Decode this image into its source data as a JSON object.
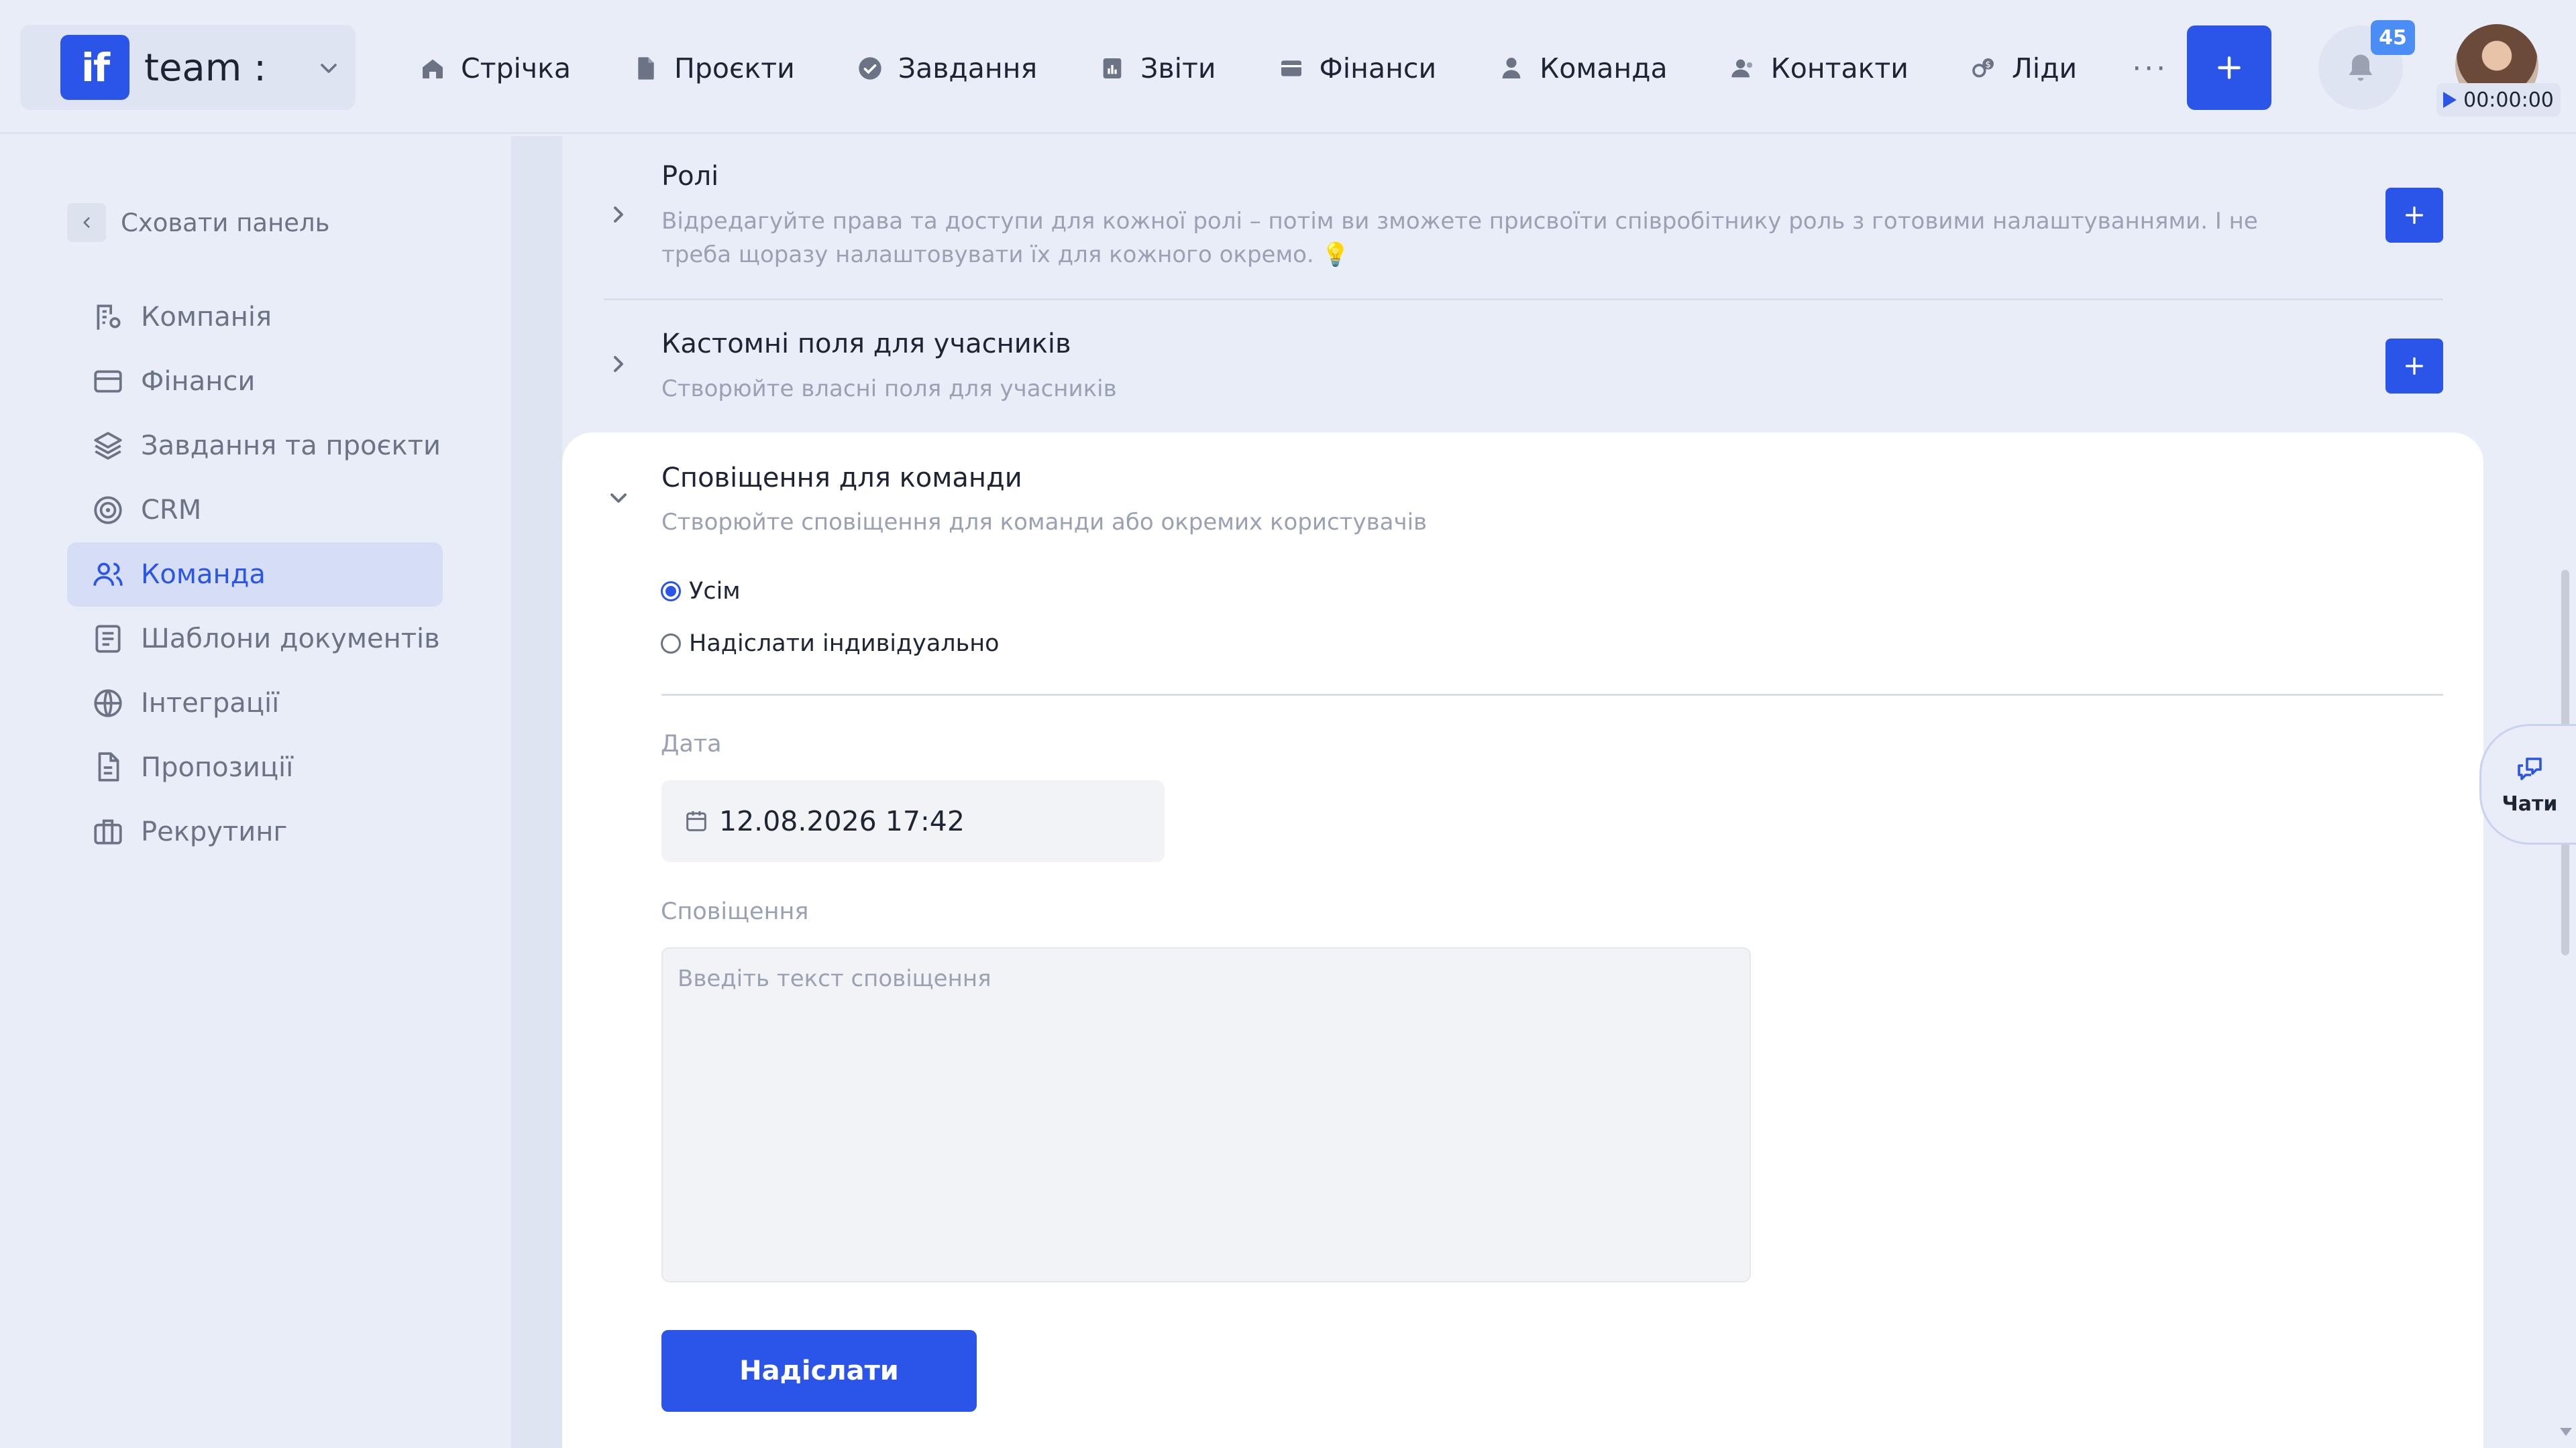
{
  "workspace": {
    "logo": "if",
    "name": "team :"
  },
  "nav": [
    {
      "label": "Стрічка",
      "icon": "home-icon"
    },
    {
      "label": "Проєкти",
      "icon": "document-icon"
    },
    {
      "label": "Завдання",
      "icon": "check-circle-icon"
    },
    {
      "label": "Звіти",
      "icon": "report-icon"
    },
    {
      "label": "Фінанси",
      "icon": "wallet-icon"
    },
    {
      "label": "Команда",
      "icon": "person-icon"
    },
    {
      "label": "Контакти",
      "icon": "contacts-icon"
    },
    {
      "label": "Ліди",
      "icon": "leads-icon"
    }
  ],
  "nav_more": "···",
  "notifications": {
    "count": "45"
  },
  "timer": "00:00:00",
  "sidebar": {
    "hide_label": "Сховати панель",
    "items": [
      {
        "label": "Компанія",
        "icon": "company-settings-icon"
      },
      {
        "label": "Фінанси",
        "icon": "card-icon"
      },
      {
        "label": "Завдання та проєкти",
        "icon": "layers-icon"
      },
      {
        "label": "CRM",
        "icon": "target-icon"
      },
      {
        "label": "Команда",
        "icon": "team-icon"
      },
      {
        "label": "Шаблони документів",
        "icon": "template-icon"
      },
      {
        "label": "Інтеграції",
        "icon": "globe-icon"
      },
      {
        "label": "Пропозиції",
        "icon": "file-icon"
      },
      {
        "label": "Рекрутинг",
        "icon": "briefcase-icon"
      }
    ],
    "active_index": 4
  },
  "sections": {
    "roles": {
      "title": "Ролі",
      "description": "Відредагуйте права та доступи для кожної ролі – потім ви зможете присвоїти співробітнику роль з готовими налаштуваннями. І не треба щоразу налаштовувати їх для кожного окремо. 💡"
    },
    "custom_fields": {
      "title": "Кастомні поля для учасників",
      "description": "Створюйте власні поля для учасників"
    },
    "notifications": {
      "title": "Сповіщення для команди",
      "description": "Створюйте сповіщення для команди або окремих користувачів",
      "recipient_options": [
        "Усім",
        "Надіслати індивідуально"
      ],
      "selected_recipient": "Усім",
      "date_label": "Дата",
      "date_value": "12.08.2026 17:42",
      "message_label": "Сповіщення",
      "message_placeholder": "Введіть текст сповіщення",
      "message_value": "",
      "submit_label": "Надіслати"
    }
  },
  "chat": {
    "label": "Чати"
  },
  "colors": {
    "accent": "#2b55e8",
    "background": "#e9edf8",
    "badge": "#4a8ef5"
  }
}
